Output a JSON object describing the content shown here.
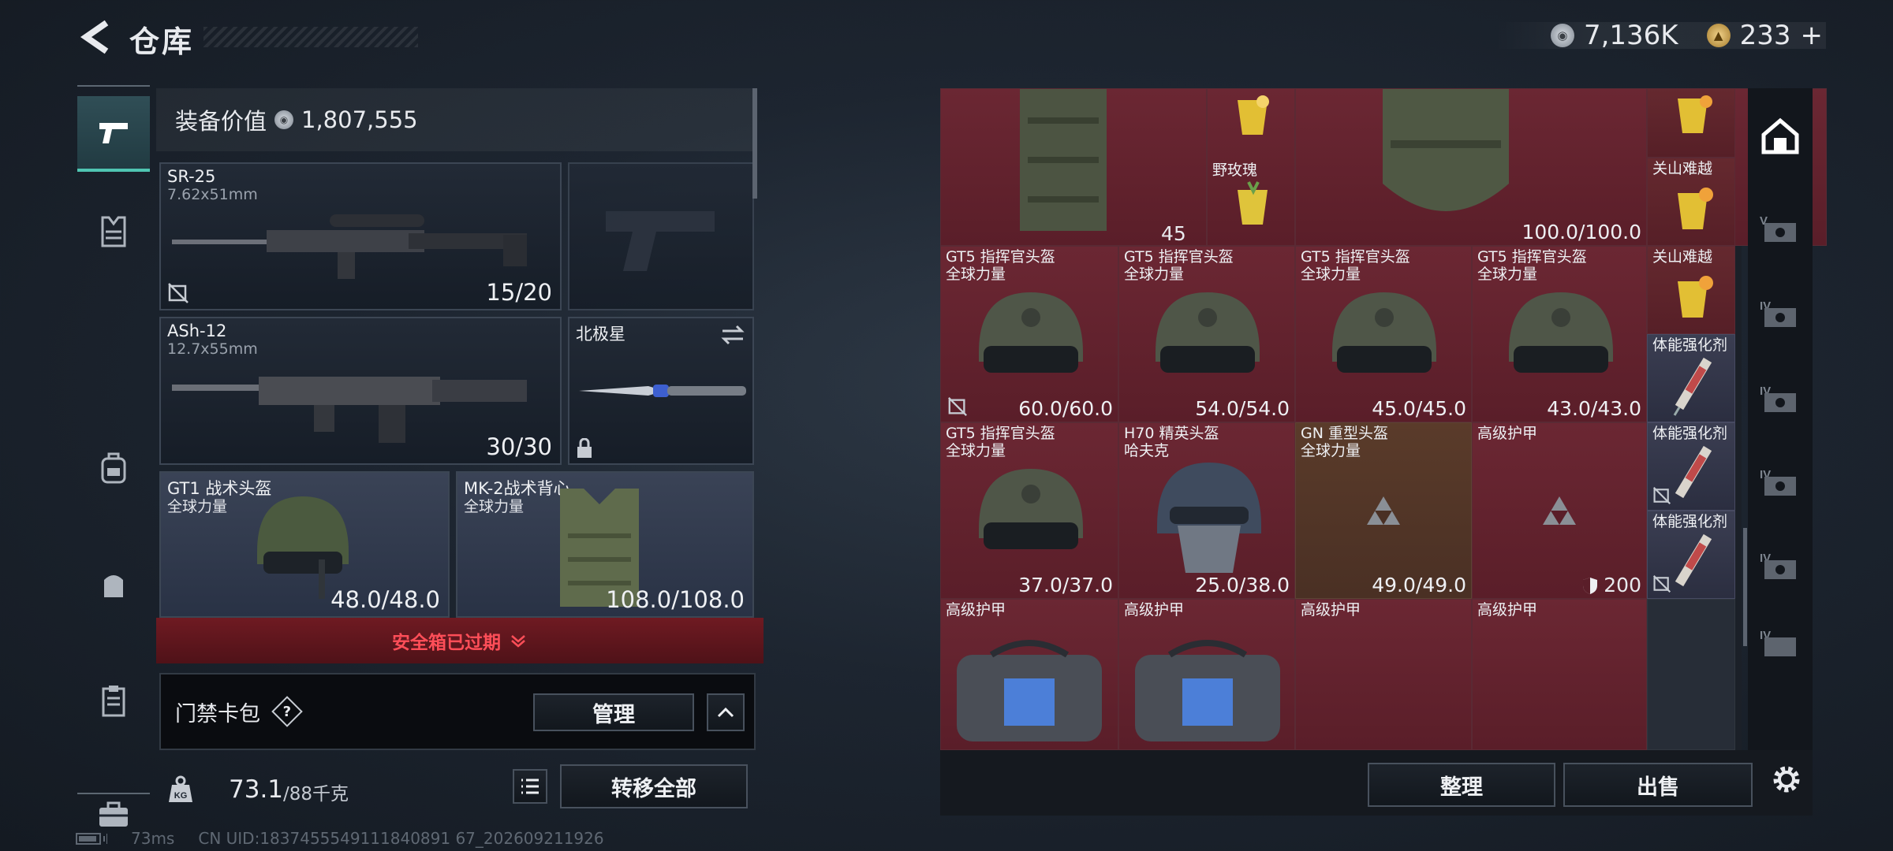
{
  "header": {
    "title": "仓库",
    "currency": [
      {
        "icon": "silver-coin-icon",
        "value": "7,136K"
      },
      {
        "icon": "gold-coin-icon",
        "value": "233"
      }
    ],
    "add_label": "+"
  },
  "nav": [
    "pistol-icon",
    "armor-icon",
    "backpack-icon",
    "pouch-icon",
    "clipboard-icon",
    "toolbox-icon"
  ],
  "equipment": {
    "value_label": "装备价值",
    "value": "1,807,555",
    "primary": {
      "name": "SR-25",
      "caliber": "7.62x51mm",
      "ammo": "15/20"
    },
    "secondary": {
      "name": "ASh-12",
      "caliber": "12.7x55mm",
      "ammo": "30/30"
    },
    "melee": {
      "name": "北极星"
    },
    "helmet": {
      "name": "GT1 战术头盔",
      "brand": "全球力量",
      "durability": "48.0/48.0"
    },
    "vest": {
      "name": "MK-2战术背心",
      "brand": "全球力量",
      "durability": "108.0/108.0"
    },
    "safebox_status": "安全箱已过期",
    "card_pack": {
      "label": "门禁卡包",
      "help": "?",
      "manage": "管理"
    },
    "weight": {
      "current": "73.1",
      "max": "/88千克"
    },
    "transfer_all": "转移全部"
  },
  "storage": {
    "cells_top": [
      {
        "name": "野玫瑰",
        "count": "45"
      },
      {
        "value": "100.0/100.0"
      },
      {
        "name": "关山难越"
      },
      {
        "name": "关山难越"
      }
    ],
    "row1": [
      {
        "name": "GT5 指挥官头盔",
        "brand": "全球力量",
        "durability": "60.0/60.0"
      },
      {
        "name": "GT5 指挥官头盔",
        "brand": "全球力量",
        "durability": "54.0/54.0"
      },
      {
        "name": "GT5 指挥官头盔",
        "brand": "全球力量",
        "durability": "45.0/45.0"
      },
      {
        "name": "GT5 指挥官头盔",
        "brand": "全球力量",
        "durability": "43.0/43.0"
      },
      {
        "name": "体能强化剂"
      }
    ],
    "row2": [
      {
        "name": "GT5 指挥官头盔",
        "brand": "全球力量",
        "durability": "37.0/37.0"
      },
      {
        "name": "H70 精英头盔",
        "brand": "哈夫克",
        "durability": "25.0/38.0"
      },
      {
        "name": "GN 重型头盔",
        "brand": "全球力量",
        "durability": "49.0/49.0"
      },
      {
        "name": "高级护甲",
        "durability": "200"
      },
      {
        "name": "体能强化剂"
      },
      {
        "name": "体能强化剂"
      }
    ],
    "row3": [
      {
        "name": "高级护甲"
      },
      {
        "name": "高级护甲"
      },
      {
        "name": "高级护甲"
      },
      {
        "name": "高级护甲"
      }
    ],
    "sort": "整理",
    "sell": "出售"
  },
  "right_nav": [
    "stash-icon",
    "V",
    "IV",
    "IV",
    "IV",
    "IV",
    "IV"
  ],
  "footer": {
    "ping": "73ms",
    "uid": "CN UID:1837455549111840891 67_202609211926"
  }
}
